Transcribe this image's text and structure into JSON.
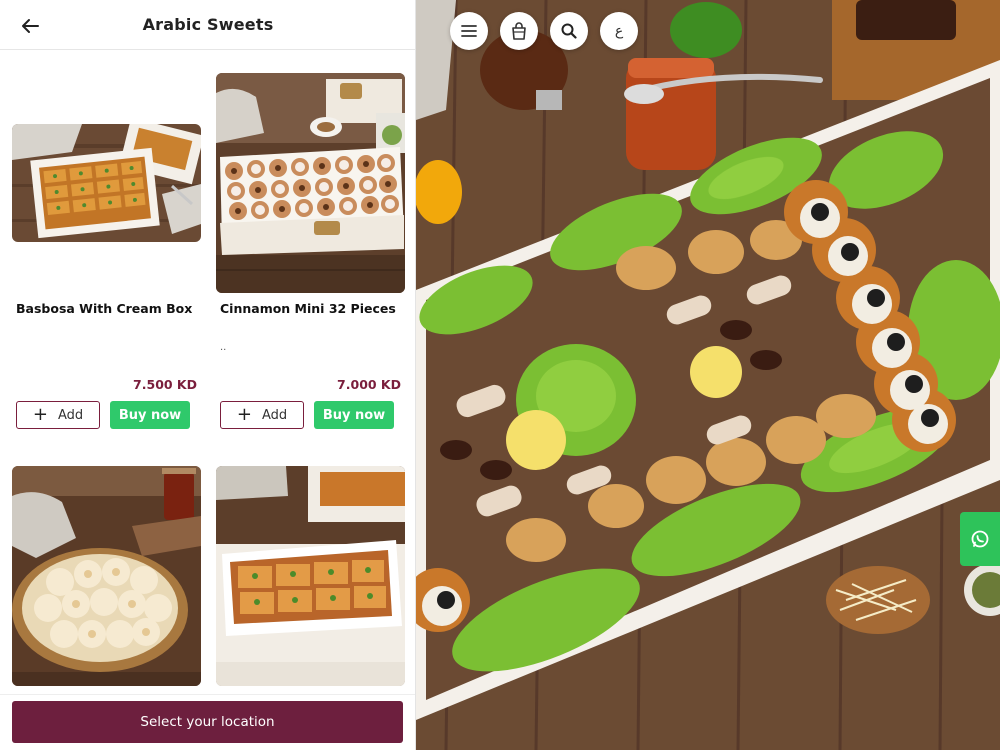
{
  "header": {
    "title": "Arabic Sweets"
  },
  "products": [
    {
      "name": "Basbosa With Cream Box",
      "description": "",
      "price": "7.500 KD",
      "add_label": "Add",
      "buy_label": "Buy now"
    },
    {
      "name": "Cinnamon Mini 32 Pieces",
      "description": "..",
      "price": "7.000 KD",
      "add_label": "Add",
      "buy_label": "Buy now"
    },
    {
      "name": "",
      "description": "",
      "price": "",
      "add_label": "",
      "buy_label": ""
    },
    {
      "name": "",
      "description": "",
      "price": "",
      "add_label": "",
      "buy_label": ""
    }
  ],
  "footer": {
    "location_label": "Select your location"
  },
  "hero_controls": {
    "menu_icon": "hamburger-icon",
    "cart_icon": "shopping-bag-icon",
    "search_icon": "search-icon",
    "language_label": "ع",
    "whatsapp_icon": "whatsapp-icon"
  },
  "colors": {
    "brand": "#6d1f3e",
    "price": "#7a1e3c",
    "buy": "#2fc96b",
    "whatsapp": "#2ec35a"
  }
}
